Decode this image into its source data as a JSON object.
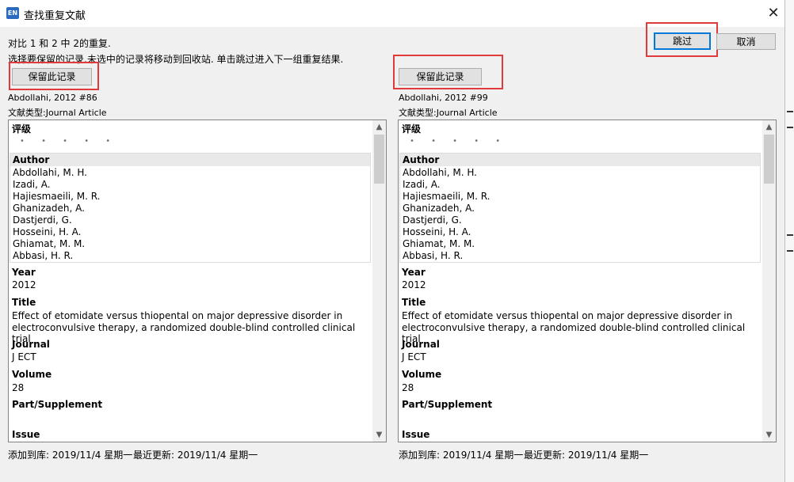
{
  "window": {
    "title": "查找重复文献",
    "app_icon_label": "EN",
    "close_glyph": "✕"
  },
  "info": {
    "line1": "对比 1 和 2 中 2的重复.",
    "line2": "选择要保留的记录.未选中的记录将移动到回收站. 单击跳过进入下一组重复结果."
  },
  "buttons": {
    "skip": "跳过",
    "cancel": "取消",
    "keep": "保留此记录"
  },
  "records": [
    {
      "ref": "Abdollahi, 2012 #86",
      "type": "文献类型:Journal Article",
      "rating_label": "评级",
      "rating_dots": "• • • • •",
      "author_label": "Author",
      "authors": [
        "Abdollahi, M. H.",
        "Izadi, A.",
        "Hajiesmaeili, M. R.",
        "Ghanizadeh, A.",
        "Dastjerdi, G.",
        "Hosseini, H. A.",
        "Ghiamat, M. M.",
        "Abbasi, H. R."
      ],
      "year_label": "Year",
      "year": "2012",
      "title_label": "Title",
      "title_line1": "Effect of etomidate versus thiopental on major depressive disorder in",
      "title_line2": "electroconvulsive therapy, a randomized double-blind controlled clinical trial",
      "journal_label": "Journal",
      "journal": "J ECT",
      "volume_label": "Volume",
      "volume": "28",
      "part_label": "Part/Supplement",
      "issue_label": "Issue",
      "added": "添加到库: 2019/11/4 星期一",
      "updated": "最近更新: 2019/11/4 星期一"
    },
    {
      "ref": "Abdollahi, 2012 #99",
      "type": "文献类型:Journal Article",
      "rating_label": "评级",
      "rating_dots": "• • • • •",
      "author_label": "Author",
      "authors": [
        "Abdollahi, M. H.",
        "Izadi, A.",
        "Hajiesmaeili, M. R.",
        "Ghanizadeh, A.",
        "Dastjerdi, G.",
        "Hosseini, H. A.",
        "Ghiamat, M. M.",
        "Abbasi, H. R."
      ],
      "year_label": "Year",
      "year": "2012",
      "title_label": "Title",
      "title_line1": "Effect of etomidate versus thiopental on major depressive disorder in",
      "title_line2": "electroconvulsive therapy, a randomized double-blind controlled clinical trial",
      "journal_label": "Journal",
      "journal": "J ECT",
      "volume_label": "Volume",
      "volume": "28",
      "part_label": "Part/Supplement",
      "issue_label": "Issue",
      "added": "添加到库: 2019/11/4 星期一",
      "updated": "最近更新: 2019/11/4 星期一"
    }
  ],
  "colors": {
    "highlight_box": "#e03a3a",
    "default_button_border": "#0078d7",
    "dialog_bg": "#f0f0f0"
  }
}
